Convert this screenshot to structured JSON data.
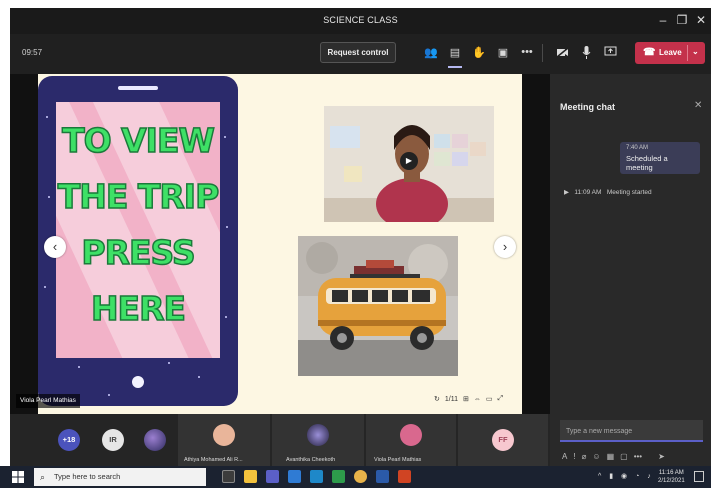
{
  "window": {
    "title": "SCIENCE CLASS"
  },
  "toolbar": {
    "timer": "09:57",
    "request_control_label": "Request control",
    "leave_label": "Leave",
    "icons": [
      "participants-icon",
      "chat-icon",
      "raise-hand-icon",
      "breakout-icon",
      "more-icon",
      "camera-off-icon",
      "mic-icon",
      "share-icon"
    ]
  },
  "slide": {
    "text_lines": [
      "TO VIEW",
      "THE TRIP",
      "PRESS",
      "HERE"
    ],
    "page_indicator": "1/11",
    "presenter_name": "Viola Pearl Mathias"
  },
  "chat": {
    "title": "Meeting chat",
    "messages": [
      {
        "time": "7:40 AM",
        "text": "Scheduled a meeting"
      }
    ],
    "system_event": {
      "time": "11:09 AM",
      "text": "Meeting started"
    },
    "compose_placeholder": "Type a new message"
  },
  "participants": {
    "avatars": [
      {
        "initials": "+18",
        "color": "#4b53bc"
      },
      {
        "initials": "IR",
        "color": "#e6e6e6"
      },
      {
        "initials": "",
        "color": "#6d5fa8"
      }
    ],
    "tiles": [
      {
        "name": "Athiya Mohamed Ali R...",
        "color": "#e9b59a"
      },
      {
        "name": "Avanthika Cheekoth",
        "color": "#3f3a5f"
      },
      {
        "name": "Viola Pearl Mathias",
        "color": "#d9688e"
      },
      {
        "initials": "FF",
        "color": "#f7c8cf"
      }
    ]
  },
  "taskbar": {
    "search_placeholder": "Type here to search",
    "time": "11:16 AM",
    "date": "2/12/2021"
  },
  "colors": {
    "accent": "#5b5fc7",
    "leave": "#c4314b",
    "slide_bg": "#fdf7e3"
  }
}
